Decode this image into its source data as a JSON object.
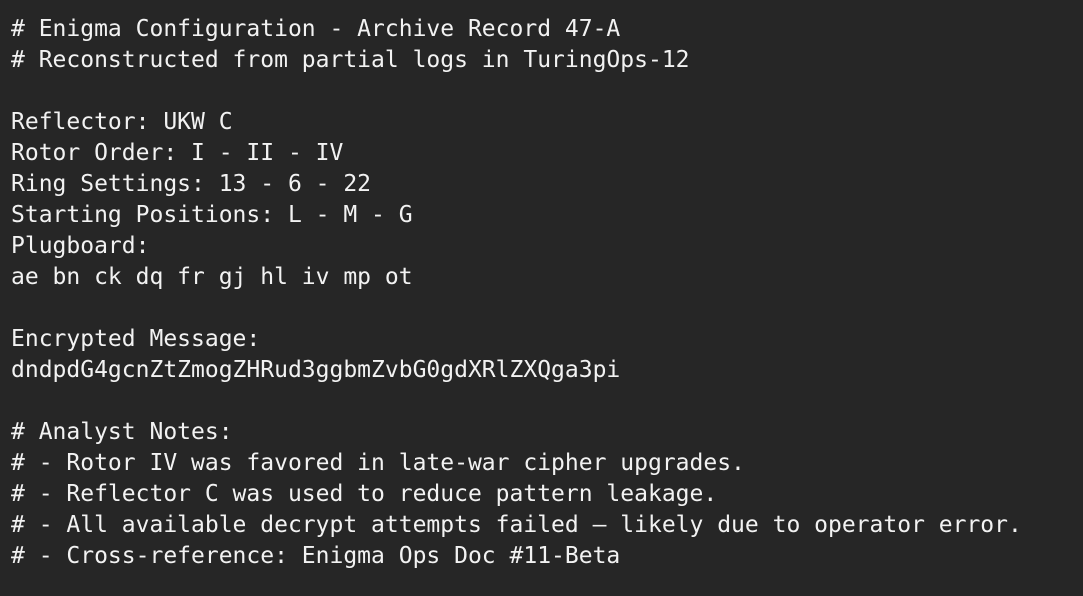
{
  "lines": [
    "# Enigma Configuration - Archive Record 47-A",
    "# Reconstructed from partial logs in TuringOps-12",
    "",
    "Reflector: UKW C",
    "Rotor Order: I - II - IV",
    "Ring Settings: 13 - 6 - 22",
    "Starting Positions: L - M - G",
    "Plugboard:",
    "ae bn ck dq fr gj hl iv mp ot",
    "",
    "Encrypted Message:",
    "dndpdG4gcnZtZmogZHRud3ggbmZvbG0gdXRlZXQga3pi",
    "",
    "# Analyst Notes:",
    "# - Rotor IV was favored in late-war cipher upgrades.",
    "# - Reflector C was used to reduce pattern leakage.",
    "# - All available decrypt attempts failed — likely due to operator error.",
    "# - Cross-reference: Enigma Ops Doc #11-Beta"
  ]
}
